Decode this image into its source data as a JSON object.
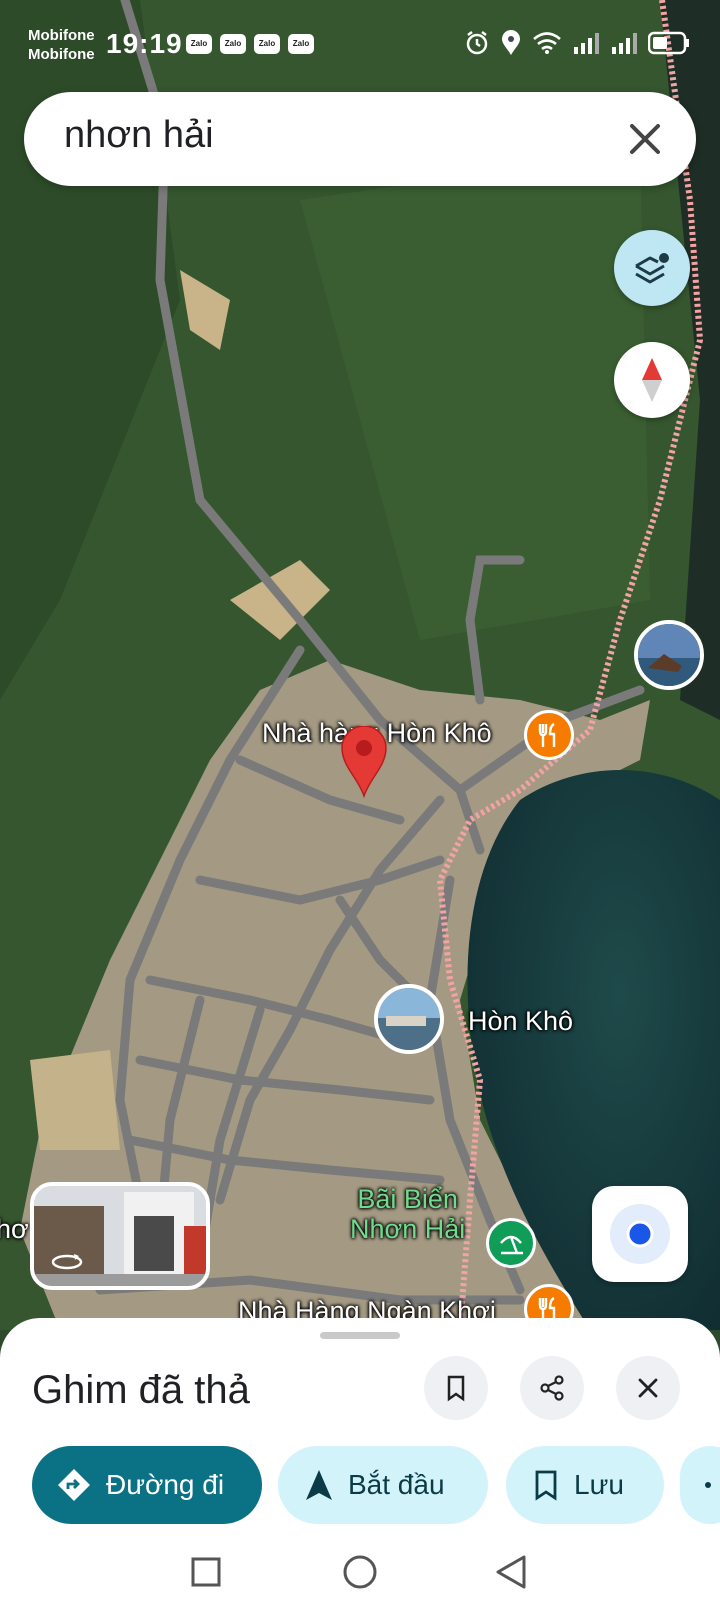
{
  "status_bar": {
    "carrier_1": "Mobifone",
    "carrier_2": "Mobifone",
    "time": "19:19",
    "notifications": [
      "Zalo",
      "Zalo",
      "Zalo",
      "Zalo"
    ],
    "icons": [
      "alarm-icon",
      "location-icon",
      "wifi-icon",
      "signal-icon",
      "signal-icon",
      "battery-icon"
    ]
  },
  "search": {
    "query": "nhơn hải"
  },
  "map": {
    "labels": {
      "restaurant_1": "Nhà hàng Hòn Khô",
      "place_1": "Hòn Khô",
      "beach_1": "Bãi Biển\nNhơn Hải",
      "restaurant_2": "Nhà Hàng Ngàn Khơi",
      "edge_text": "hơ"
    },
    "colors": {
      "pin": "#e53935",
      "restaurant": "#f57c00",
      "beach": "#0f9d58",
      "boundary": "#ef9a9a"
    }
  },
  "sheet": {
    "title": "Ghim đã thả",
    "actions": {
      "directions": "Đường đi",
      "start": "Bắt đầu",
      "save": "Lưu"
    },
    "colors": {
      "primary": "#0b7285",
      "tonal": "#d3f3fb"
    }
  }
}
